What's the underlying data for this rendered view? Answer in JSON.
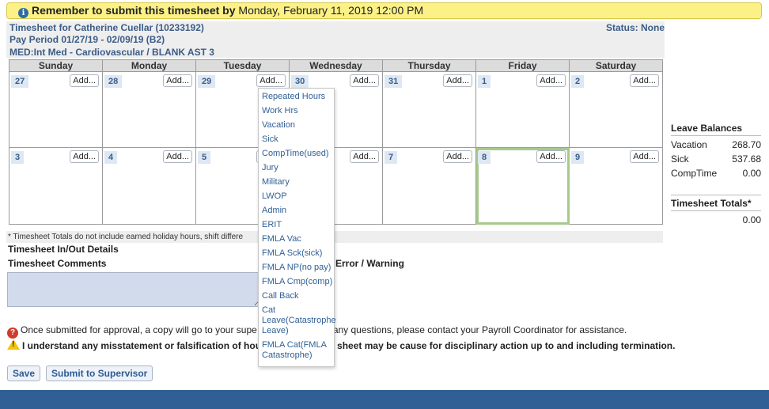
{
  "reminder": {
    "bold": "Remember to submit this timesheet by",
    "date": "Monday, February 11, 2019 12:00 PM"
  },
  "header": {
    "line1": "Timesheet for Catherine Cuellar (10233192)",
    "line2": "Pay Period 01/27/19 - 02/09/19 (B2)",
    "line3": "MED:Int Med - Cardiovascular / BLANK AST 3",
    "status": "Status: None"
  },
  "calendar": {
    "days": [
      "Sunday",
      "Monday",
      "Tuesday",
      "Wednesday",
      "Thursday",
      "Friday",
      "Saturday"
    ],
    "add_label": "Add...",
    "week1": [
      "27",
      "28",
      "29",
      "30",
      "31",
      "1",
      "2"
    ],
    "week2": [
      "3",
      "4",
      "5",
      "6",
      "7",
      "8",
      "9"
    ]
  },
  "leave_balances": {
    "title": "Leave Balances",
    "rows": [
      {
        "label": "Vacation",
        "value": "268.70"
      },
      {
        "label": "Sick",
        "value": "537.68"
      },
      {
        "label": "CompTime",
        "value": "0.00"
      }
    ]
  },
  "totals": {
    "title": "Timesheet Totals*",
    "value": "0.00"
  },
  "note": "* Timesheet Totals do not include earned holiday hours, shift differe",
  "inout_title": "Timesheet In/Out Details",
  "comments_title": "Timesheet Comments",
  "error_warning": "Error / Warning",
  "messages": {
    "submit_a": "Once submitted for approval, a copy will go to your supe",
    "submit_b": "any questions, please contact your Payroll Coordinator for assistance.",
    "warn_a": "I understand any misstatement or falsification of hou",
    "warn_b": "sheet may be cause for disciplinary action up to and including termination."
  },
  "buttons": {
    "save": "Save",
    "submit": "Submit to Supervisor"
  },
  "dropdown": [
    "Repeated Hours",
    "Work Hrs",
    "Vacation",
    "Sick",
    "CompTime(used)",
    "Jury",
    "Military",
    "LWOP",
    "Admin",
    "ERIT",
    "FMLA Vac",
    "FMLA Sck(sick)",
    "FMLA NP(no pay)",
    "FMLA Cmp(comp)",
    "Call Back",
    "Cat Leave(Catastrophe Leave)",
    "FMLA Cat(FMLA Catastrophe)"
  ]
}
